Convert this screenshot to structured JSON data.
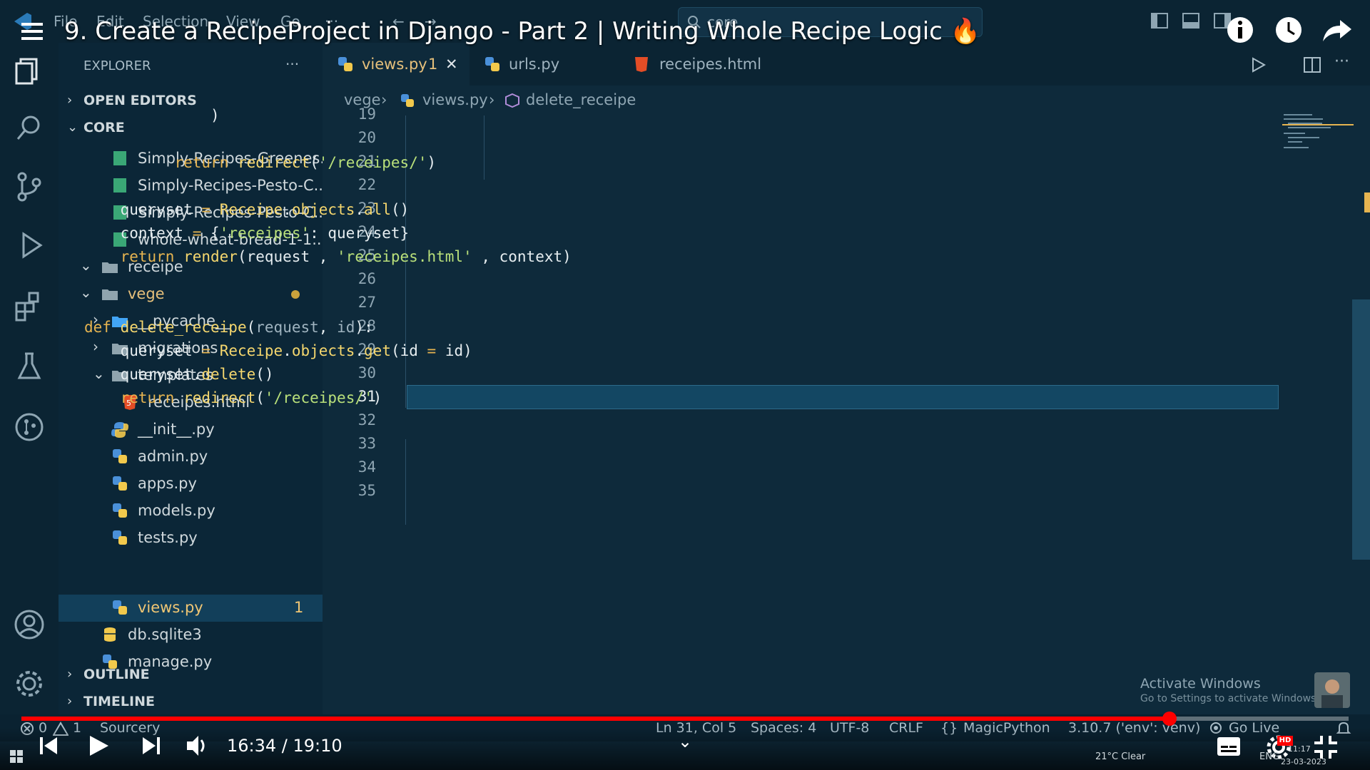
{
  "video": {
    "title": "9. Create a RecipeProject in Django - Part 2 | Writing Whole Recipe Logic 🔥",
    "time": "16:34 / 19:10",
    "progress_fraction": 0.865
  },
  "menu": {
    "file": "File",
    "edit": "Edit",
    "selection": "Selection",
    "view": "View",
    "go": "Go",
    "more": "···"
  },
  "command_center": {
    "label": "core"
  },
  "sidebar": {
    "title": "EXPLORER",
    "more": "···",
    "open_editors": "OPEN EDITORS",
    "core": "CORE",
    "outline": "OUTLINE",
    "timeline": "TIMELINE",
    "files": [
      {
        "label": "Simply-Recipes-Greenes...",
        "type": "image"
      },
      {
        "label": "Simply-Recipes-Pesto-C...",
        "type": "image"
      },
      {
        "label": "Simply-Recipes-Pesto-C...",
        "type": "image"
      },
      {
        "label": "whole-wheat-bread-1-1...",
        "type": "image"
      },
      {
        "label": "receipe",
        "type": "folder"
      },
      {
        "label": "vege",
        "type": "folder"
      },
      {
        "label": "__pycache__",
        "type": "folder"
      },
      {
        "label": "migrations",
        "type": "folder"
      },
      {
        "label": "templates",
        "type": "folder"
      },
      {
        "label": "receipes.html",
        "type": "html"
      },
      {
        "label": "__init__.py",
        "type": "python"
      },
      {
        "label": "admin.py",
        "type": "python"
      },
      {
        "label": "apps.py",
        "type": "python"
      },
      {
        "label": "models.py",
        "type": "python"
      },
      {
        "label": "tests.py",
        "type": "python"
      },
      {
        "label": "views.py",
        "type": "python",
        "badge": "1"
      },
      {
        "label": "db.sqlite3",
        "type": "db"
      },
      {
        "label": "manage.py",
        "type": "python"
      }
    ]
  },
  "tabs": [
    {
      "label": "views.py",
      "badge": "1",
      "active": true
    },
    {
      "label": "urls.py",
      "active": false
    },
    {
      "label": "receipes.html",
      "active": false
    }
  ],
  "breadcrumb": {
    "folder": "vege",
    "file": "views.py",
    "symbol": "delete_receipe"
  },
  "editor": {
    "line_numbers": [
      "19",
      "20",
      "21",
      "22",
      "23",
      "24",
      "25",
      "26",
      "27",
      "28",
      "29",
      "30",
      "31",
      "32",
      "33",
      "34",
      "35"
    ],
    "current_line": "31"
  },
  "status": {
    "errors": "0",
    "warnings": "1",
    "sourcery": "Sourcery",
    "position": "Ln 31, Col 5",
    "spaces": "Spaces: 4",
    "encoding": "UTF-8",
    "eol": "CRLF",
    "language": "MagicPython",
    "interpreter": "3.10.7 ('env': venv)",
    "golive": "Go Live"
  },
  "watermark": {
    "line1": "Activate Windows",
    "line2": "Go to Settings to activate Windows."
  },
  "taskbar": {
    "weather": "21°C Clear",
    "lang": "ENG",
    "time": "11:17",
    "date": "23-03-2023"
  },
  "colors": {
    "accent": "#e6b450",
    "keyword": "#e6b450",
    "string": "#b9e07a",
    "progress": "#ff0000",
    "background": "#0e2a3b"
  }
}
